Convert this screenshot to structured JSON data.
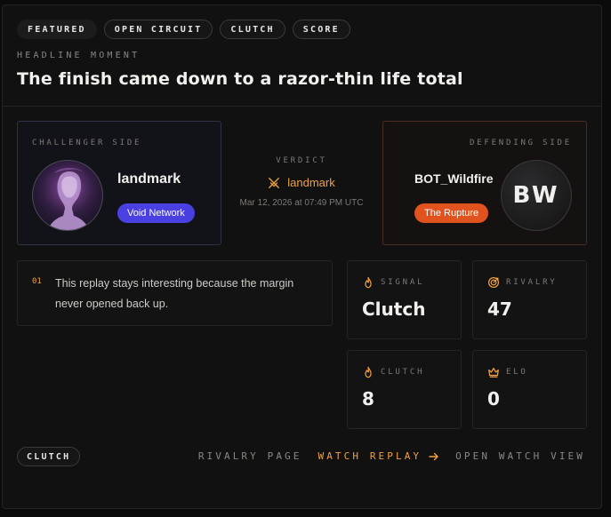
{
  "tags": [
    "FEATURED",
    "OPEN CIRCUIT",
    "CLUTCH",
    "SCORE"
  ],
  "kicker": "HEADLINE MOMENT",
  "headline": "The finish came down to a razor-thin life total",
  "challenger": {
    "label": "CHALLENGER SIDE",
    "name": "landmark",
    "team": "Void Network"
  },
  "defender": {
    "label": "DEFENDING SIDE",
    "name": "BOT_Wildfire",
    "team": "The Rupture",
    "initials": "BW"
  },
  "verdict": {
    "label": "VERDICT",
    "winner": "landmark",
    "time": "Mar 12, 2026 at 07:49 PM UTC"
  },
  "note": {
    "index": "01",
    "text": "This replay stays interesting because the margin never opened back up."
  },
  "stats": [
    {
      "label": "SIGNAL",
      "value": "Clutch",
      "icon": "flame-icon"
    },
    {
      "label": "RIVALRY",
      "value": "47",
      "icon": "target-icon"
    },
    {
      "label": "CLUTCH",
      "value": "8",
      "icon": "flame-icon"
    },
    {
      "label": "ELO",
      "value": "0",
      "icon": "crown-icon"
    }
  ],
  "footer": {
    "tag": "CLUTCH",
    "rivalry_link": "RIVALRY PAGE",
    "watch_replay": "WATCH REPLAY",
    "open_watch": "OPEN WATCH VIEW"
  },
  "colors": {
    "accent": "#f0a040",
    "challenger_team": "#4a3fe0",
    "defender_team": "#e0531e"
  }
}
